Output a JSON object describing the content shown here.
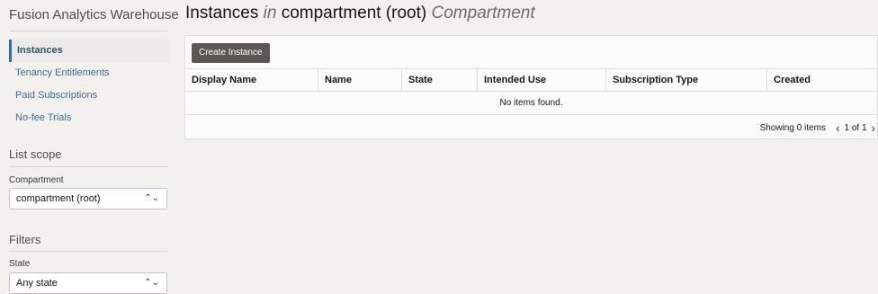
{
  "sidebar": {
    "app_title": "Fusion Analytics Warehouse",
    "nav": [
      {
        "label": "Instances"
      },
      {
        "label": "Tenancy Entitlements"
      },
      {
        "label": "Paid Subscriptions"
      },
      {
        "label": "No-fee Trials"
      }
    ],
    "list_scope": {
      "heading": "List scope",
      "compartment_label": "Compartment",
      "compartment_value": "compartment (root)"
    },
    "filters": {
      "heading": "Filters",
      "state_label": "State",
      "state_value": "Any state"
    }
  },
  "main": {
    "title_prefix": "Instances",
    "title_in": "in",
    "title_compartment": "compartment (root)",
    "title_suffix": "Compartment",
    "create_button": "Create Instance",
    "columns": [
      "Display Name",
      "Name",
      "State",
      "Intended Use",
      "Subscription Type",
      "Created"
    ],
    "empty_message": "No items found.",
    "pager": {
      "showing": "Showing 0 items",
      "page": "1 of 1"
    }
  }
}
